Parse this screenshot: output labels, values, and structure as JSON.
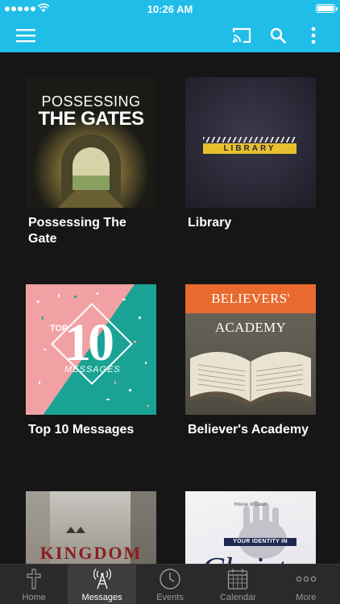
{
  "status_bar": {
    "time": "10:26 AM"
  },
  "header": {
    "icons": [
      "menu-icon",
      "cast-icon",
      "search-icon",
      "more-vertical-icon"
    ]
  },
  "series": [
    {
      "title": "Possessing The Gate",
      "art_line1": "POSSESSING",
      "art_line2": "THE GATES"
    },
    {
      "title": "Library",
      "art_text": "LIBRARY"
    },
    {
      "title": "Top 10 Messages",
      "art_top": "TOP",
      "art_number": "10",
      "art_messages": "MESSAGES"
    },
    {
      "title": "Believer's Academy",
      "art_text": "BELIEVERS' ACADEMY"
    },
    {
      "title": "",
      "art_text": "KINGDOM"
    },
    {
      "title": "",
      "art_small": "House of Dawn",
      "art_band": "YOUR IDENTITY IN",
      "art_script": "Christ"
    }
  ],
  "tabs": [
    {
      "label": "Home",
      "icon": "cross-icon"
    },
    {
      "label": "Messages",
      "icon": "broadcast-tower-icon",
      "active": true
    },
    {
      "label": "Events",
      "icon": "clock-icon"
    },
    {
      "label": "Calendar",
      "icon": "calendar-icon"
    },
    {
      "label": "More",
      "icon": "ellipsis-icon"
    }
  ],
  "colors": {
    "accent": "#1fbde8",
    "background": "#161616",
    "tab_bar": "#2a2a2a"
  }
}
